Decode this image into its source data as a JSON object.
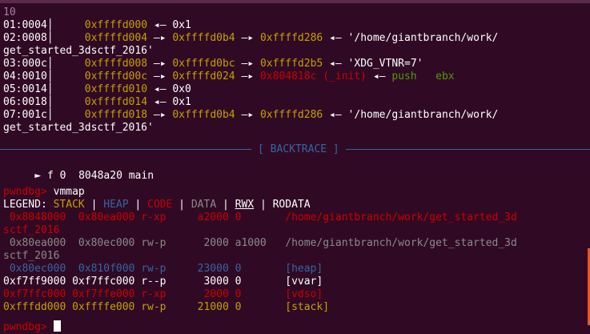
{
  "top_value": "10",
  "stack": [
    {
      "idx": "01:0004",
      "addr": "0xffffd000",
      "chain": [
        {
          "t": "0x1",
          "c": "c-w"
        }
      ]
    },
    {
      "idx": "02:0008",
      "addr": "0xffffd004",
      "chain": [
        {
          "t": "0xffffd0b4",
          "c": "c-y"
        },
        {
          "t": "0xffffd286",
          "c": "c-y"
        },
        {
          "t": "'/home/giantbranch/work/",
          "c": "c-w"
        }
      ]
    },
    {
      "idx": "",
      "addr": "",
      "chain": [
        {
          "t": "get_started_3dsctf_2016'",
          "c": "c-w"
        }
      ],
      "wrap": true
    },
    {
      "idx": "03:000c",
      "addr": "0xffffd008",
      "chain": [
        {
          "t": "0xffffd0bc",
          "c": "c-y"
        },
        {
          "t": "0xffffd2b5",
          "c": "c-y"
        },
        {
          "t": "'XDG_VTNR=7'",
          "c": "c-w"
        }
      ]
    },
    {
      "idx": "04:0010",
      "addr": "0xffffd00c",
      "chain": [
        {
          "t": "0xffffd024",
          "c": "c-y"
        },
        {
          "t": "0x804818c (_init)",
          "c": "c-r"
        },
        {
          "t": "push   ebx",
          "c": "c-g"
        }
      ]
    },
    {
      "idx": "05:0014",
      "addr": "0xffffd010",
      "chain": [
        {
          "t": "0x0",
          "c": "c-w"
        }
      ]
    },
    {
      "idx": "06:0018",
      "addr": "0xffffd014",
      "chain": [
        {
          "t": "0x1",
          "c": "c-w"
        }
      ]
    },
    {
      "idx": "07:001c",
      "addr": "0xffffd018",
      "chain": [
        {
          "t": "0xffffd0b4",
          "c": "c-y"
        },
        {
          "t": "0xffffd286",
          "c": "c-y"
        },
        {
          "t": "'/home/giantbranch/work/",
          "c": "c-w"
        }
      ]
    },
    {
      "idx": "",
      "addr": "",
      "chain": [
        {
          "t": "get_started_3dsctf_2016'",
          "c": "c-w"
        }
      ],
      "wrap": true
    }
  ],
  "backtrace_label": "[ BACKTRACE ]",
  "backtrace": {
    "marker": "►",
    "frame": "f 0",
    "addr": "8048a20",
    "sym": "main"
  },
  "prompt": "pwndbg>",
  "command": "vmmap",
  "legend": {
    "title": "LEGEND:",
    "stack": "STACK",
    "heap": "HEAP",
    "code": "CODE",
    "data": "DATA",
    "rwx": "RWX",
    "rodata": "RODATA"
  },
  "vmmap": [
    {
      "start": "0x8048000",
      "end": "0x80ea000",
      "perm": "r-xp",
      "size": "a2000",
      "off": "0",
      "name": "/home/giantbranch/work/get_started_3d",
      "cont": "sctf_2016",
      "cls": "c-r"
    },
    {
      "start": "0x80ea000",
      "end": "0x80ec000",
      "perm": "rw-p",
      "size": "2000",
      "off": "a1000",
      "name": "/home/giantbranch/work/get_started_3d",
      "cont": "sctf_2016",
      "cls": "c-gr"
    },
    {
      "start": "0x80ec000",
      "end": "0x810f000",
      "perm": "rw-p",
      "size": "23000",
      "off": "0",
      "name": "[heap]",
      "cont": "",
      "cls": "c-b"
    },
    {
      "start": "0xf7ff9000",
      "end": "0xf7ffc000",
      "perm": "r--p",
      "size": "3000",
      "off": "0",
      "name": "[vvar]",
      "cont": "",
      "cls": "c-w"
    },
    {
      "start": "0xf7ffc000",
      "end": "0xf7ffe000",
      "perm": "r-xp",
      "size": "2000",
      "off": "0",
      "name": "[vdso]",
      "cont": "",
      "cls": "c-r"
    },
    {
      "start": "0xfffdd000",
      "end": "0xffffe000",
      "perm": "rw-p",
      "size": "21000",
      "off": "0",
      "name": "[stack]",
      "cont": "",
      "cls": "c-y"
    }
  ],
  "arrow_right": "—▸",
  "arrow_left": "◂—"
}
